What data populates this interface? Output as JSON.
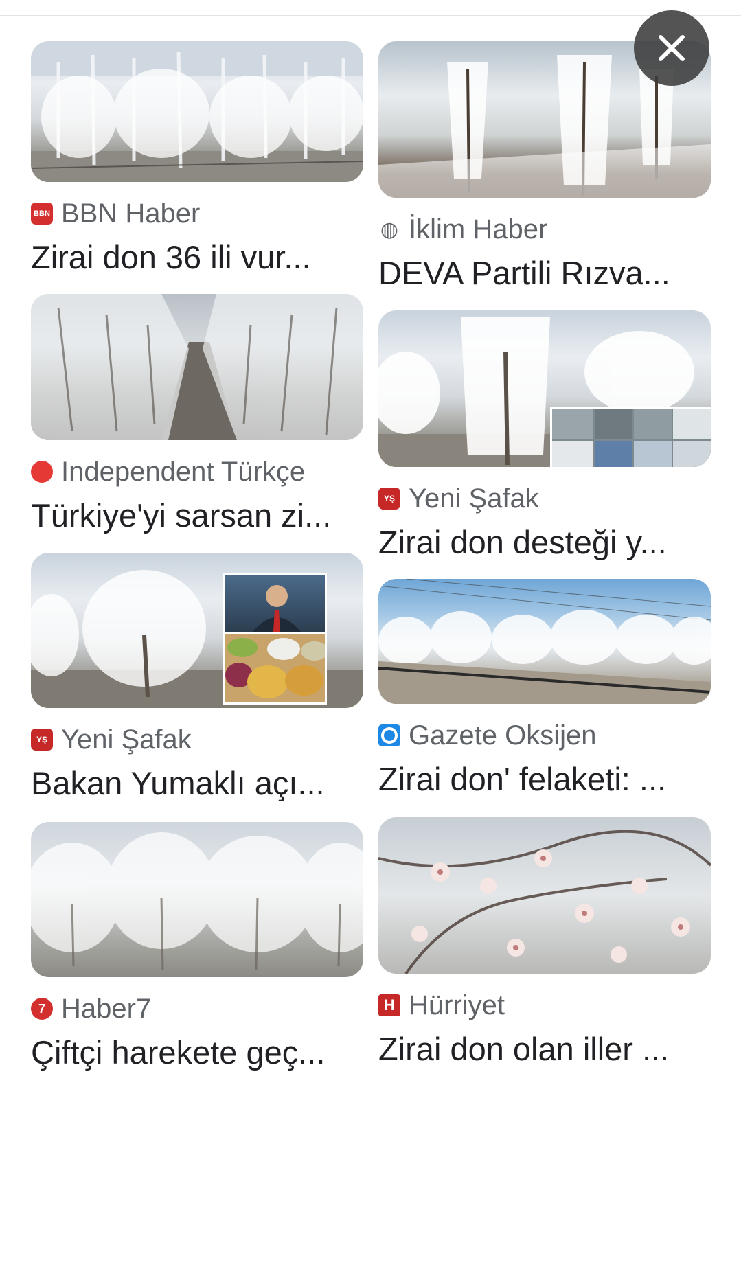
{
  "close_button": {
    "icon": "close-icon",
    "glyph": "✕"
  },
  "results": [
    {
      "source": "BBN Haber",
      "title": "Zirai don 36 ili vur...",
      "favicon": {
        "icon": "bbn-logo-icon",
        "text": "BBN",
        "color": "#d32f2f"
      }
    },
    {
      "source": "İklim Haber",
      "title": "DEVA Partili Rızva...",
      "favicon": {
        "icon": "globe-icon",
        "text": "",
        "color": "#5f6368"
      }
    },
    {
      "source": "Independent Türkçe",
      "title": "Türkiye'yi sarsan zi...",
      "favicon": {
        "icon": "independent-logo-icon",
        "text": "",
        "color": "#e53935"
      }
    },
    {
      "source": "Yeni Şafak",
      "title": "Zirai don desteği y...",
      "favicon": {
        "icon": "yeni-safak-logo-icon",
        "text": "YŞ",
        "color": "#c62828"
      }
    },
    {
      "source": "Yeni Şafak",
      "title": "Bakan Yumaklı açı...",
      "favicon": {
        "icon": "yeni-safak-logo-icon",
        "text": "YŞ",
        "color": "#c62828"
      }
    },
    {
      "source": "Gazete Oksijen",
      "title": "Zirai don' felaketi: ...",
      "favicon": {
        "icon": "gazete-oksijen-logo-icon",
        "text": "",
        "color": "#1e88e5"
      }
    },
    {
      "source": "Haber7",
      "title": "Çiftçi harekete geç...",
      "favicon": {
        "icon": "haber7-logo-icon",
        "text": "7",
        "color": "#d32f2f"
      }
    },
    {
      "source": "Hürriyet",
      "title": "Zirai don olan iller ...",
      "favicon": {
        "icon": "hurriyet-logo-icon",
        "text": "H",
        "color": "#c62828"
      }
    }
  ]
}
